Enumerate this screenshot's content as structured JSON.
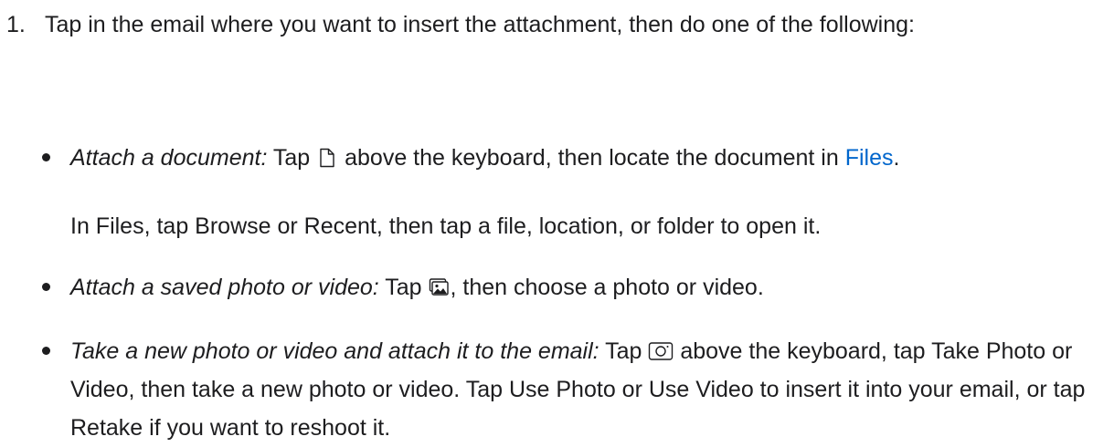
{
  "step": {
    "number": "1.",
    "text": "Tap in the email where you want to insert the attachment, then do one of the following:"
  },
  "bullets": [
    {
      "italic": "Attach a document:",
      "before_icon": " Tap ",
      "icon": "document-icon",
      "after_icon": " above the keyboard, then locate the document in ",
      "link": "Files",
      "end": "."
    },
    {
      "italic": "Attach a saved photo or video:",
      "before_icon": " Tap ",
      "icon": "photos-icon",
      "after_icon": ", then choose a photo or video."
    },
    {
      "italic": "Take a new photo or video and attach it to the email:",
      "before_icon": " Tap ",
      "icon": "camera-icon",
      "after_icon": " above the keyboard, tap Take Photo or Video, then take a new photo or video. Tap Use Photo or Use Video to insert it into your email, or tap Retake if you want to reshoot it."
    }
  ],
  "files_note": "In Files, tap Browse or Recent, then tap a file, location, or folder to open it.",
  "colors": {
    "text": "#1d1d1f",
    "link": "#0066cc"
  }
}
